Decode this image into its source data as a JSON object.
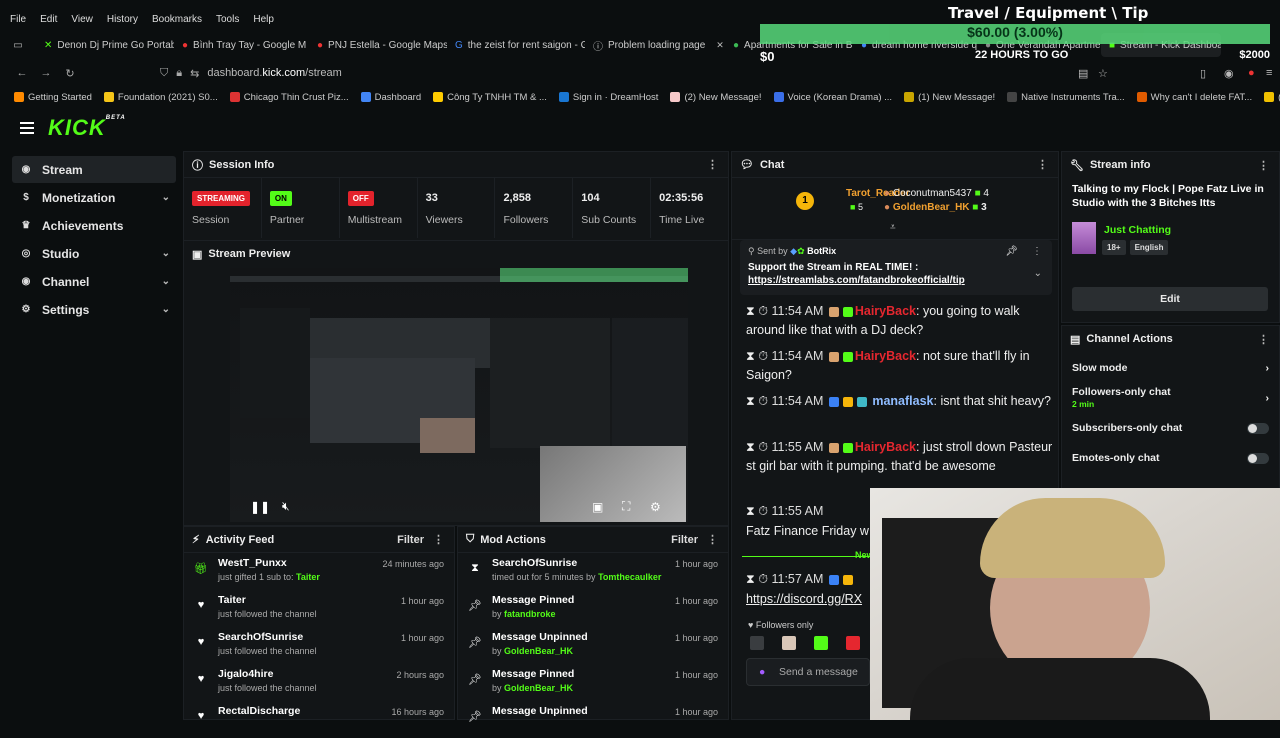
{
  "browser": {
    "menu": [
      "File",
      "Edit",
      "View",
      "History",
      "Bookmarks",
      "Tools",
      "Help"
    ],
    "tabs": [
      {
        "label": "Denon Dj Prime Go Portab"
      },
      {
        "label": "Bình Tray Tay - Google M"
      },
      {
        "label": "PNJ Estella - Google Maps"
      },
      {
        "label": "the zeist for rent saigon - G"
      },
      {
        "label": "Problem loading page"
      },
      {
        "label": "Apartments for Sale in Bi"
      },
      {
        "label": "dream home riverside qu"
      },
      {
        "label": "One Verandah Apartment"
      },
      {
        "label": "Stream - Kick Dashboard"
      }
    ],
    "url_prefix": "dashboard.",
    "url_host": "kick.com",
    "url_path": "/stream",
    "bookmarks": [
      {
        "label": "Getting Started",
        "color": "#ff8a00"
      },
      {
        "label": "Foundation (2021) S0...",
        "color": "#f5c518"
      },
      {
        "label": "Chicago Thin Crust Piz...",
        "color": "#d33"
      },
      {
        "label": "Dashboard",
        "color": "#4285f4"
      },
      {
        "label": "Công Ty TNHH TM & ...",
        "color": "#ffcc00"
      },
      {
        "label": "Sign in · DreamHost",
        "color": "#1976d2"
      },
      {
        "label": "(2) New Message!",
        "color": "#f7c9c9"
      },
      {
        "label": "Voice (Korean Drama) ...",
        "color": "#3a6ee8"
      },
      {
        "label": "(1) New Message!",
        "color": "#c9a500"
      },
      {
        "label": "Native Instruments Tra...",
        "color": "#444"
      },
      {
        "label": "Why can't I delete FAT...",
        "color": "#e05b00"
      },
      {
        "label": "(1) New Message!",
        "color": "#f0c000"
      },
      {
        "label": "Trigger Boxing",
        "color": "#555"
      }
    ]
  },
  "app": {
    "logo": "KICK",
    "logo_sup": "BETA"
  },
  "sidebar": [
    {
      "label": "Stream",
      "icon": "broadcast-icon",
      "chev": ""
    },
    {
      "label": "Monetization",
      "icon": "dollar-icon",
      "chev": "⌄"
    },
    {
      "label": "Achievements",
      "icon": "trophy-icon",
      "chev": ""
    },
    {
      "label": "Studio",
      "icon": "studio-icon",
      "chev": "⌄"
    },
    {
      "label": "Channel",
      "icon": "eye-icon",
      "chev": "⌄"
    },
    {
      "label": "Settings",
      "icon": "gear-icon",
      "chev": "⌄"
    }
  ],
  "session": {
    "title": "Session Info",
    "stats": [
      {
        "value": "STREAMING",
        "label": "Session",
        "badge": "red"
      },
      {
        "value": "ON",
        "label": "Partner",
        "badge": "green"
      },
      {
        "value": "OFF",
        "label": "Multistream",
        "badge": "red"
      },
      {
        "value": "33",
        "label": "Viewers",
        "badge": ""
      },
      {
        "value": "2,858",
        "label": "Followers",
        "badge": ""
      },
      {
        "value": "104",
        "label": "Sub Counts",
        "badge": ""
      },
      {
        "value": "02:35:56",
        "label": "Time Live",
        "badge": ""
      }
    ]
  },
  "preview": {
    "title": "Stream Preview"
  },
  "activity": {
    "title": "Activity Feed",
    "filter": "Filter",
    "items": [
      {
        "name": "WestT_Punxx",
        "desc": "just gifted 1 sub to: ",
        "target": "Taiter",
        "time": "24 minutes ago",
        "icon": "gift-icon"
      },
      {
        "name": "Taiter",
        "desc": "just followed the channel",
        "target": "",
        "time": "1 hour ago",
        "icon": "heart-icon"
      },
      {
        "name": "SearchOfSunrise",
        "desc": "just followed the channel",
        "target": "",
        "time": "1 hour ago",
        "icon": "heart-icon"
      },
      {
        "name": "Jigalo4hire",
        "desc": "just followed the channel",
        "target": "",
        "time": "2 hours ago",
        "icon": "heart-icon"
      },
      {
        "name": "RectalDischarge",
        "desc": "",
        "target": "",
        "time": "16 hours ago",
        "icon": "heart-icon"
      }
    ]
  },
  "mod": {
    "title": "Mod Actions",
    "filter": "Filter",
    "items": [
      {
        "name": "SearchOfSunrise",
        "desc": "timed out for 5 minutes by ",
        "target": "Tomthecaulker",
        "time": "1 hour ago",
        "icon": "hourglass-icon"
      },
      {
        "name": "Message Pinned",
        "desc": "by ",
        "target": "fatandbroke",
        "time": "1 hour ago",
        "icon": "pin-icon"
      },
      {
        "name": "Message Unpinned",
        "desc": "by ",
        "target": "GoldenBear_HK",
        "time": "1 hour ago",
        "icon": "pin-icon"
      },
      {
        "name": "Message Pinned",
        "desc": "by ",
        "target": "GoldenBear_HK",
        "time": "1 hour ago",
        "icon": "pin-icon"
      },
      {
        "name": "Message Unpinned",
        "desc": "",
        "target": "",
        "time": "1 hour ago",
        "icon": "pin-icon"
      }
    ]
  },
  "chat": {
    "title": "Chat",
    "top_user": "Tarot_Reader",
    "top_count": "5",
    "top_rank": "1",
    "u2": "Coconutman5437",
    "u2c": "4",
    "u3": "GoldenBear_HK",
    "u3c": "3",
    "pinned_by_label": "Sent by",
    "pinned_by": "BotRix",
    "pinned_text": "Support the Stream in REAL TIME! : ",
    "pinned_link": "https://streamlabs.com/fatandbrokeofficial/tip",
    "messages": [
      {
        "time": "11:54 AM",
        "user": "HairyBack",
        "text": ": you going to walk around like that with a DJ deck?",
        "cls": "u-red"
      },
      {
        "time": "11:54 AM",
        "user": "HairyBack",
        "text": ": not sure that'll fly in Saigon?",
        "cls": "u-red"
      },
      {
        "time": "11:54 AM",
        "user": "manaflask",
        "text": ": isnt that shit heavy?",
        "cls": "u-blue"
      },
      {
        "time": "11:55 AM",
        "user": "HairyBack",
        "text": ": just stroll down Pasteur st girl bar with it pumping. that'd be awesome",
        "cls": "u-red"
      },
      {
        "time": "11:55 AM",
        "user": "",
        "text": "",
        "cls": ""
      }
    ],
    "fatz_line": "Fatz Finance Friday w",
    "new_label": "New",
    "last_time": "11:57 AM",
    "last_link": "https://discord.gg/RX",
    "followers_only": "Followers only",
    "send_placeholder": "Send a message"
  },
  "stream_info": {
    "title": "Stream info",
    "stream_title": "Talking to my Flock | Pope Fatz Live in Studio with the 3 Bitches Itts",
    "category": "Just Chatting",
    "tags": [
      "18+",
      "English"
    ],
    "edit": "Edit"
  },
  "channel_actions": {
    "title": "Channel Actions",
    "rows": [
      {
        "label": "Slow mode",
        "sub": "",
        "kind": "arrow"
      },
      {
        "label": "Followers-only chat",
        "sub": "2 min",
        "kind": "arrow"
      },
      {
        "label": "Subscribers-only chat",
        "sub": "",
        "kind": "toggle"
      },
      {
        "label": "Emotes-only chat",
        "sub": "",
        "kind": "toggle"
      }
    ]
  },
  "overlay": {
    "title": "Travel / Equipment \\ Tip",
    "goal": "$60.00 (3.00%)",
    "hours": "22 HOURS TO GO",
    "min": "$0",
    "max": "$2000"
  },
  "colors": {
    "kick_green": "#53fc18",
    "red": "#e3232c"
  }
}
